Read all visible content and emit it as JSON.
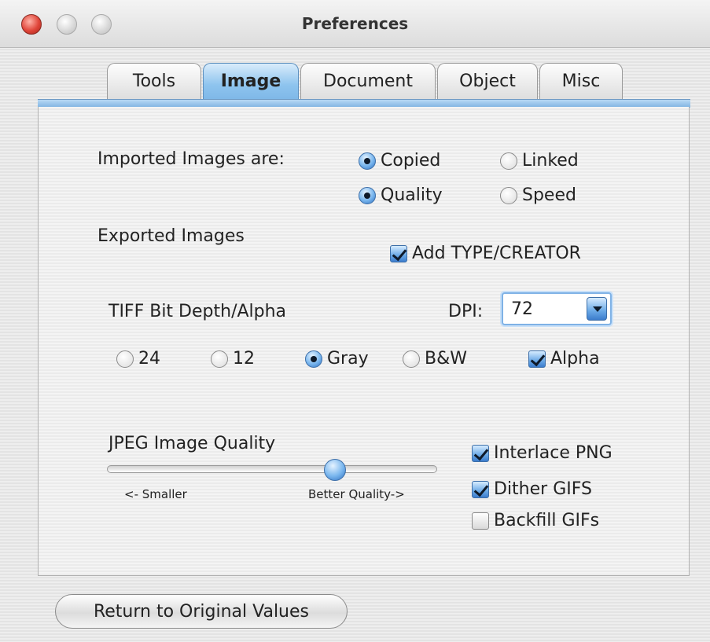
{
  "window": {
    "title": "Preferences"
  },
  "tabs": [
    {
      "label": "Tools"
    },
    {
      "label": "Image"
    },
    {
      "label": "Document"
    },
    {
      "label": "Object"
    },
    {
      "label": "Misc"
    }
  ],
  "imported": {
    "label": "Imported Images are:",
    "copied": "Copied",
    "linked": "Linked",
    "quality": "Quality",
    "speed": "Speed"
  },
  "exported": {
    "label": "Exported Images",
    "add_type_creator": "Add TYPE/CREATOR"
  },
  "tiff": {
    "label": "TIFF Bit Depth/Alpha",
    "dpi_label": "DPI:",
    "dpi_value": "72",
    "opt24": "24",
    "opt12": "12",
    "gray": "Gray",
    "bw": "B&W",
    "alpha": "Alpha"
  },
  "jpeg": {
    "label": "JPEG Image Quality",
    "smaller": "<- Smaller",
    "better": "Better Quality->"
  },
  "png_gif": {
    "interlace_png": "Interlace PNG",
    "dither_gifs": "Dither GIFS",
    "backfill_gifs": "Backfill GIFs"
  },
  "buttons": {
    "return": "Return to Original Values"
  }
}
